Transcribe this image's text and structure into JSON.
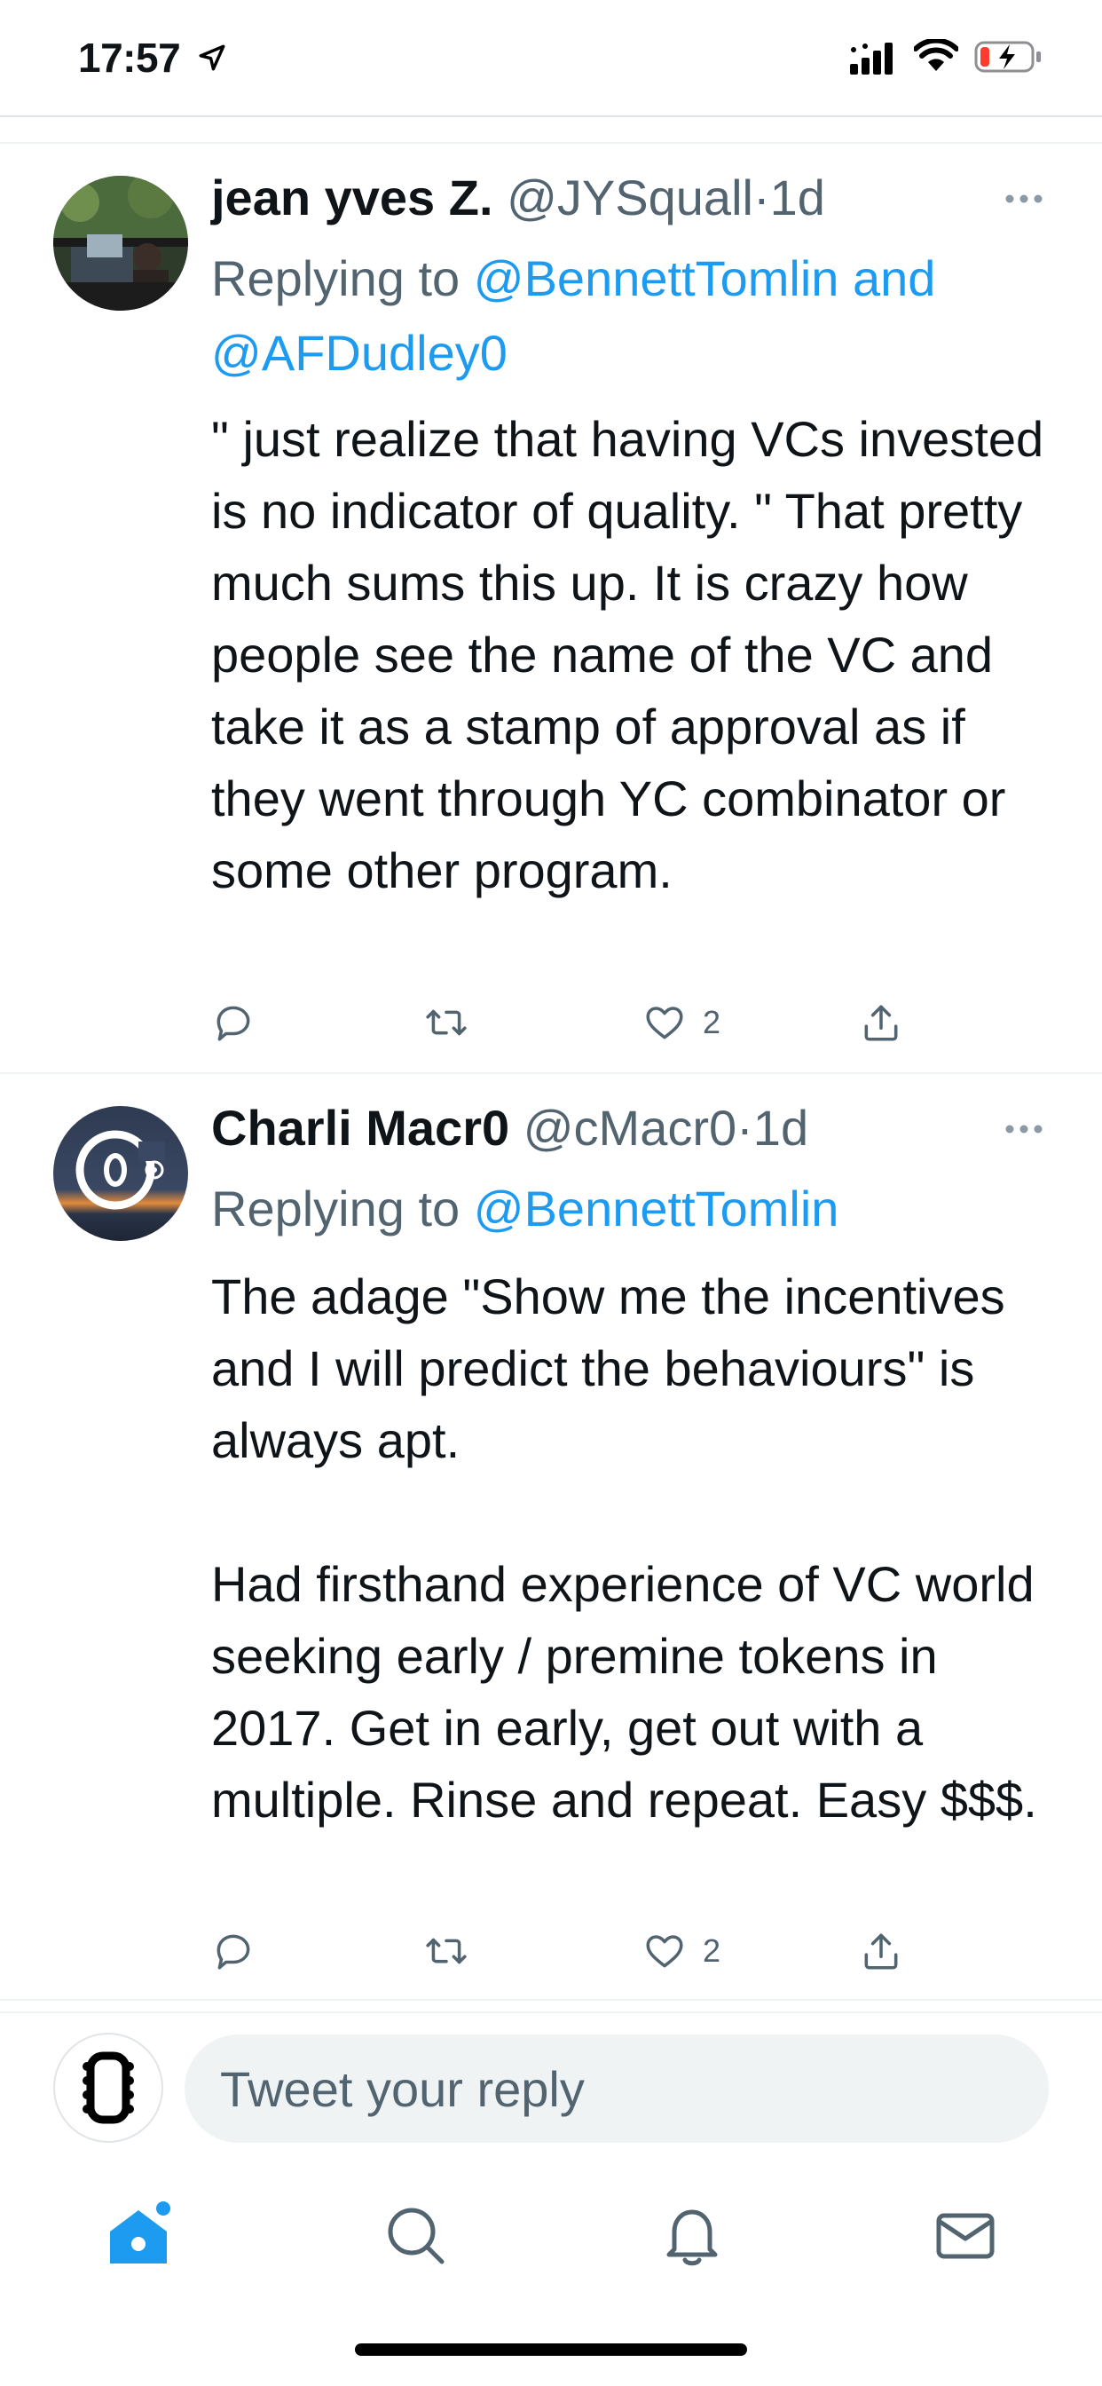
{
  "status_bar": {
    "time": "17:57"
  },
  "tweets": [
    {
      "display_name": "jean yves Z.",
      "handle": "@JYSquall",
      "separator": "·",
      "time": "1d",
      "replying_prefix": "Replying to ",
      "replying_mentions": "@BennettTomlin and @AFDudley0",
      "text": "\" just realize that having VCs invested is no indicator of quality. \" That pretty much sums this up. It is crazy how people see the name of the VC and take it as a stamp of approval as if they went through YC combinator or some other program.",
      "like_count": "2",
      "avatar_icon": "photo-avatar-icon"
    },
    {
      "display_name": "Charli Macr0",
      "handle": "@cMacr0",
      "separator": "·",
      "time": "1d",
      "replying_prefix": "Replying to ",
      "replying_mentions": "@BennettTomlin",
      "text": "The adage \"Show me the incentives and I will predict the behaviours\" is always apt.\n\nHad firsthand experience of VC world seeking early / premine tokens in 2017. Get in early, get out with a multiple. Rinse and repeat. Easy $$$.",
      "like_count": "2",
      "avatar_icon": "logo-avatar-icon"
    }
  ],
  "reply_bar": {
    "placeholder": "Tweet your reply"
  },
  "tab_bar": {
    "items": [
      "home-icon",
      "search-icon",
      "bell-icon",
      "mail-icon"
    ]
  },
  "colors": {
    "accent": "#1d9bf0",
    "secondary_text": "#536471",
    "primary_text": "#0f1419",
    "divider": "#eff3f4"
  }
}
